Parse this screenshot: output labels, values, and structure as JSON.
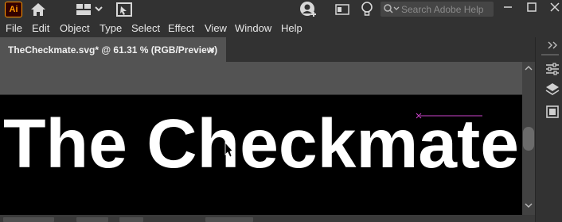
{
  "app": {
    "logo_text": "Ai",
    "logo_color": "#ff9a00",
    "search_placeholder": "Search Adobe Help"
  },
  "menu": [
    "File",
    "Edit",
    "Object",
    "Type",
    "Select",
    "Effect",
    "View",
    "Window",
    "Help"
  ],
  "document_tab": {
    "title": "TheCheckmate.svg* @ 61.31 % (RGB/Preview)",
    "close_glyph": "×"
  },
  "artboard": {
    "headline": "The Checkmate",
    "background": "#000000",
    "text_color": "#ffffff",
    "guide_color": "#cc44cc"
  },
  "icons": {
    "home": "home-icon",
    "workspace": "workspace-switcher-icon",
    "arrange": "arrange-documents-icon",
    "user": "user-icon",
    "panel": "panel-toggle-icon",
    "discover": "lightbulb-icon",
    "search": "search-icon",
    "properties": "properties-sliders-icon",
    "layers": "layers-icon",
    "libraries": "libraries-icon"
  }
}
